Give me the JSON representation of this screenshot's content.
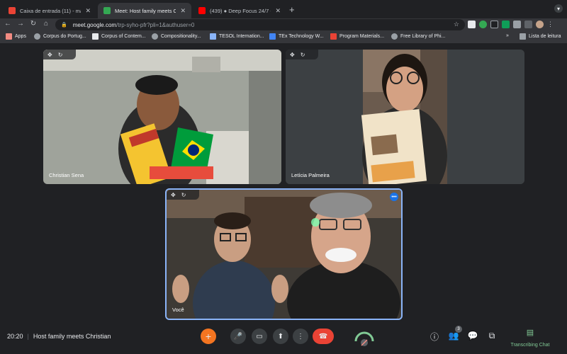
{
  "browser": {
    "tabs": [
      {
        "title": "Caixa de entrada (11) - magnol",
        "favicon_color": "#ea4335"
      },
      {
        "title": "Meet: Host family meets C",
        "favicon_color": "#34a853",
        "active": true
      },
      {
        "title": "(439) ● Deep Focus 24/7 - A",
        "favicon_color": "#ff0000"
      }
    ],
    "new_tab": "+",
    "url_host": "meet.google.com",
    "url_path": "/trp-syho-pfr?pli=1&authuser=0",
    "bookmarks": [
      "Apps",
      "Corpus do Portug...",
      "Corpus of Contem...",
      "Compositionality...",
      "TESOL Internation...",
      "TEx Technology W...",
      "Program Materials...",
      "Free Library of Phi..."
    ],
    "overflow": "»",
    "reading_list": "Lista de leitura"
  },
  "participants": [
    {
      "name": "Christian Sena",
      "colors": {
        "bg": "#9fa39b",
        "shirt": "#2b2b2b"
      }
    },
    {
      "name": "Letícia Palmeira",
      "colors": {
        "bg": "#6b5b4e",
        "shirt": "#2a2a2a"
      }
    },
    {
      "name": "Você",
      "colors": {
        "bg": "#3e3a35",
        "shirt": "#2f3c4f"
      }
    }
  ],
  "footer": {
    "time": "20:20",
    "separator": "|",
    "meeting_title": "Host family meets Christian",
    "people_count": "3",
    "transcribing_label": "Transcribing Chat"
  },
  "icons": {
    "effects": "+",
    "mic": "🎙",
    "camera": "▣",
    "present": "⇧",
    "more": "⋮",
    "end_call": "☎",
    "info": "ⓘ",
    "people": "👥",
    "chat": "▤",
    "activities": "✦"
  }
}
